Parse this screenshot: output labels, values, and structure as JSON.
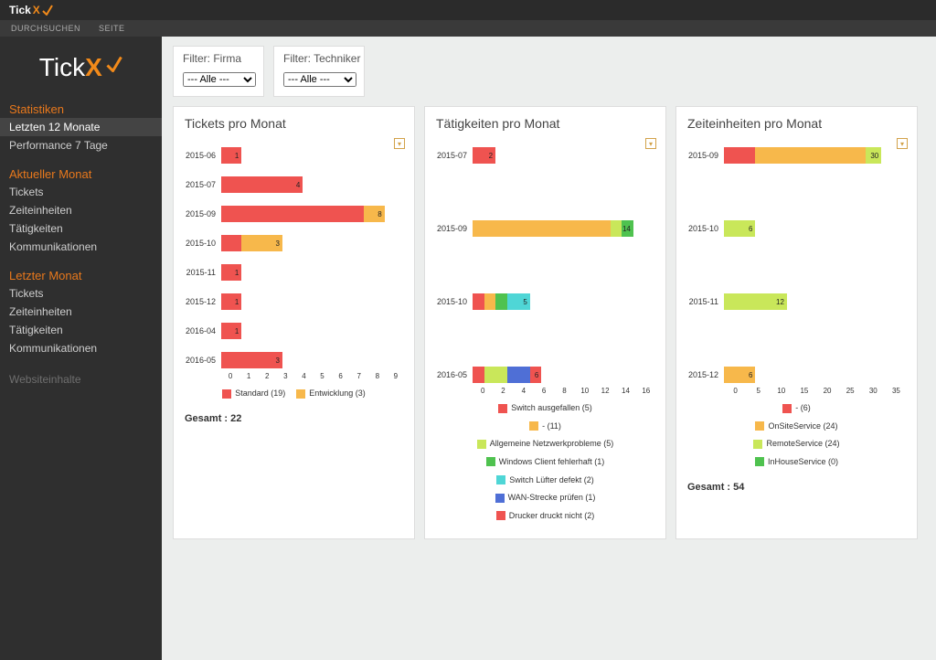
{
  "app": {
    "brand_prefix": "Tick",
    "brand_x": "X"
  },
  "nav": {
    "item1": "DURCHSUCHEN",
    "item2": "SEITE"
  },
  "sidebar": {
    "logo_prefix": "Tick",
    "logo_x": "X",
    "sec1": "Statistiken",
    "sec1_items": [
      "Letzten 12 Monate",
      "Performance 7 Tage"
    ],
    "sec2": "Aktueller Monat",
    "sec2_items": [
      "Tickets",
      "Zeiteinheiten",
      "Tätigkeiten",
      "Kommunikationen"
    ],
    "sec3": "Letzter Monat",
    "sec3_items": [
      "Tickets",
      "Zeiteinheiten",
      "Tätigkeiten",
      "Kommunikationen"
    ],
    "sec4": "Websiteinhalte"
  },
  "filters": {
    "firma_label": "Filter: Firma",
    "techniker_label": "Filter: Techniker",
    "alle": "--- Alle ---"
  },
  "chart_data": [
    {
      "type": "bar",
      "orientation": "horizontal",
      "stacked": true,
      "title": "Tickets pro Monat",
      "xlim": [
        0,
        9
      ],
      "ticks": [
        0,
        1,
        2,
        3,
        4,
        5,
        6,
        7,
        8,
        9
      ],
      "categories": [
        "2015-06",
        "2015-07",
        "2015-09",
        "2015-10",
        "2015-11",
        "2015-12",
        "2016-04",
        "2016-05"
      ],
      "series": [
        {
          "name": "Standard (19)",
          "color": "#ef5350",
          "values": [
            1,
            4,
            7,
            1,
            1,
            1,
            1,
            3
          ],
          "labels": [
            "1",
            "4",
            "",
            "",
            "1",
            "1",
            "1",
            "3"
          ]
        },
        {
          "name": "Entwicklung (3)",
          "color": "#f7b84b",
          "values": [
            0,
            0,
            1,
            2,
            0,
            0,
            0,
            0
          ],
          "labels": [
            "",
            "",
            "8",
            "3",
            "",
            "",
            "",
            ""
          ]
        }
      ],
      "total_label": "Gesamt : 22"
    },
    {
      "type": "bar",
      "orientation": "horizontal",
      "stacked": true,
      "title": "Tätigkeiten pro Monat",
      "xlim": [
        0,
        16
      ],
      "ticks": [
        0,
        2,
        4,
        6,
        8,
        10,
        12,
        14,
        16
      ],
      "categories": [
        "2015-07",
        "2015-09",
        "2015-10",
        "2016-05"
      ],
      "series": [
        {
          "name": "Switch ausgefallen (5)",
          "color": "#ef5350",
          "values": [
            2,
            0,
            1,
            1
          ],
          "labels": [
            "2",
            "",
            "",
            ""
          ]
        },
        {
          "name": "- (11)",
          "color": "#f7b84b",
          "values": [
            0,
            12,
            1,
            0
          ],
          "labels": [
            "",
            "",
            "",
            ""
          ]
        },
        {
          "name": "Allgemeine Netzwerkprobleme (5)",
          "color": "#c9e75a",
          "values": [
            0,
            1,
            0,
            2
          ],
          "labels": [
            "",
            "",
            "",
            ""
          ]
        },
        {
          "name": "Windows Client fehlerhaft (1)",
          "color": "#4fc24f",
          "values": [
            0,
            1,
            1,
            0
          ],
          "labels": [
            "",
            "14",
            "",
            ""
          ]
        },
        {
          "name": "Switch Lüfter defekt (2)",
          "color": "#4fd6d6",
          "values": [
            0,
            0,
            2,
            0
          ],
          "labels": [
            "",
            "",
            "5",
            ""
          ]
        },
        {
          "name": "WAN-Strecke prüfen (1)",
          "color": "#4f6fd6",
          "values": [
            0,
            0,
            0,
            2
          ],
          "labels": [
            "",
            "",
            "",
            ""
          ]
        },
        {
          "name": "Drucker druckt nicht (2)",
          "color": "#ef5350",
          "values": [
            0,
            0,
            0,
            1
          ],
          "labels": [
            "",
            "",
            "",
            "6"
          ]
        }
      ]
    },
    {
      "type": "bar",
      "orientation": "horizontal",
      "stacked": true,
      "title": "Zeiteinheiten pro Monat",
      "xlim": [
        0,
        35
      ],
      "ticks": [
        0,
        5,
        10,
        15,
        20,
        25,
        30,
        35
      ],
      "categories": [
        "2015-09",
        "2015-10",
        "2015-11",
        "2015-12"
      ],
      "series": [
        {
          "name": "- (6)",
          "color": "#ef5350",
          "values": [
            6,
            0,
            0,
            0
          ],
          "labels": [
            "",
            "",
            "",
            ""
          ]
        },
        {
          "name": "OnSiteService (24)",
          "color": "#f7b84b",
          "values": [
            21,
            0,
            0,
            6
          ],
          "labels": [
            "",
            "",
            "",
            "6"
          ]
        },
        {
          "name": "RemoteService (24)",
          "color": "#c9e75a",
          "values": [
            3,
            6,
            12,
            0
          ],
          "labels": [
            "30",
            "6",
            "12",
            ""
          ]
        },
        {
          "name": "InHouseService (0)",
          "color": "#4fc24f",
          "values": [
            0,
            0,
            0,
            0
          ],
          "labels": [
            "",
            "",
            "",
            ""
          ]
        }
      ],
      "total_label": "Gesamt : 54"
    }
  ]
}
